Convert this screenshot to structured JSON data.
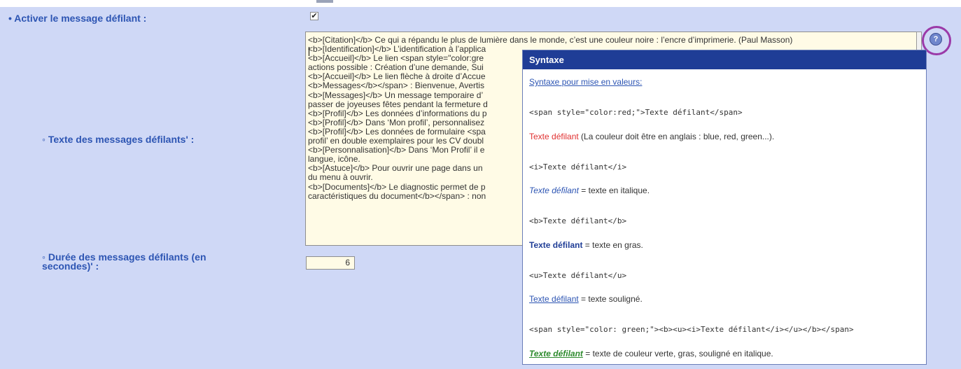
{
  "form": {
    "enable_label": "• Activer le message défilant :",
    "enable_check": "✔",
    "texts_label": "◦ Texte des messages défilants' :",
    "duration_label": "◦ Durée des messages défilants (en secondes)' :",
    "duration_value": "6"
  },
  "textarea": {
    "content": "<b>[Citation]</b> Ce qui a répandu le plus de lumière dans le monde, c’est une couleur noire : l’encre d’imprimerie. (Paul Masson)\n<b>[Identification]</b> L’identification à l’applica\n<b>[Accueil]</b> Le lien <span style=\"color:gre\nactions possible : Création d’une demande, Sui\n<b>[Accueil]</b> Le lien flèche à droite d’Accue\n<b>Messages</b></span> : Bienvenue, Avertis\n<b>[Messages]</b> Un message temporaire d’\npasser de joyeuses fêtes pendant la fermeture d\n<b>[Profil]</b> Les données d’informations du p\n<b>[Profil]</b> Dans ‘Mon profil’, personnalisez\n<b>[Profil]</b> Les données de formulaire <spa\nprofil’ en double exemplaires pour les CV doubl\n<b>[Personnalisation]</b> Dans ‘Mon Profil’ il e\nlangue, icône.\n<b>[Astuce]</b> Pour ouvrir une page dans un\ndu menu à ouvrir.\n<b>[Documents]</b> Le diagnostic permet de p\ncaractéristiques du document</b></span> : non"
  },
  "help": {
    "icon": "?"
  },
  "popup": {
    "title": "Syntaxe",
    "intro": "Syntaxe pour mise en valeurs:",
    "code1": "<span style=\"color:red;\">Texte défilant</span>",
    "ex1_styled": "Texte défilant",
    "ex1_rest": " (La couleur doit être en anglais : blue, red, green...).",
    "code2": "<i>Texte défilant</i>",
    "ex2_styled": "Texte défilant",
    "ex2_rest": " = texte en italique.",
    "code3": "<b>Texte défilant</b>",
    "ex3_styled": "Texte défilant",
    "ex3_rest": " = texte en gras.",
    "code4": "<u>Texte défilant</u>",
    "ex4_styled": "Texte défilant",
    "ex4_rest": " = texte souligné.",
    "code5": "<span style=\"color: green;\"><b><u><i>Texte défilant</i></u></b></span>",
    "ex5_styled": "Texte défilant",
    "ex5_rest": " = texte de couleur verte, gras, souligné en italique."
  },
  "colors": {
    "panel_bg": "#cfd8f6",
    "label_blue": "#2d55b3",
    "popup_header": "#1f3d96",
    "highlight_ring": "#9b3aa8",
    "red_text": "#e03030",
    "green_text": "#2d8a2d"
  }
}
